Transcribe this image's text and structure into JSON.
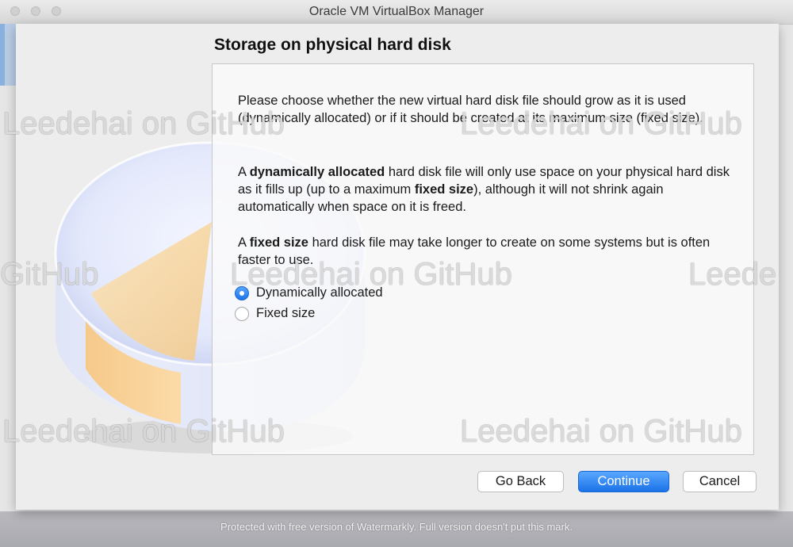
{
  "window": {
    "title": "Oracle VM VirtualBox Manager"
  },
  "wizard": {
    "heading": "Storage on physical hard disk",
    "para1": "Please choose whether the new virtual hard disk file should grow as it is used (dynamically allocated) or if it should be created at its maximum size (fixed size).",
    "para2": {
      "t1": "A ",
      "b1": "dynamically allocated",
      "t2": " hard disk file will only use space on your physical hard disk as it fills up (up to a maximum ",
      "b2": "fixed size",
      "t3": "), although it will not shrink again automatically when space on it is freed."
    },
    "para3": {
      "t1": "A ",
      "b1": "fixed size",
      "t2": " hard disk file may take longer to create on some systems but is often faster to use."
    },
    "options": [
      {
        "label": "Dynamically allocated",
        "selected": true
      },
      {
        "label": "Fixed size",
        "selected": false
      }
    ],
    "buttons": {
      "back": "Go Back",
      "continue": "Continue",
      "cancel": "Cancel"
    }
  },
  "watermark": {
    "text": "Leedehai on GitHub",
    "partial_left": "GitHub",
    "partial_right": "Leede",
    "banner": "Protected with free version of Watermarkly. Full version doesn't put this mark."
  },
  "colors": {
    "accent": "#1c74e8",
    "disk_orange": "#f8d39a",
    "disk_blue": "#c9d3f0"
  },
  "icons": {
    "illustration": "hard-disk-illustration",
    "radio_selected": "radio-selected-icon",
    "radio_unselected": "radio-unselected-icon"
  }
}
